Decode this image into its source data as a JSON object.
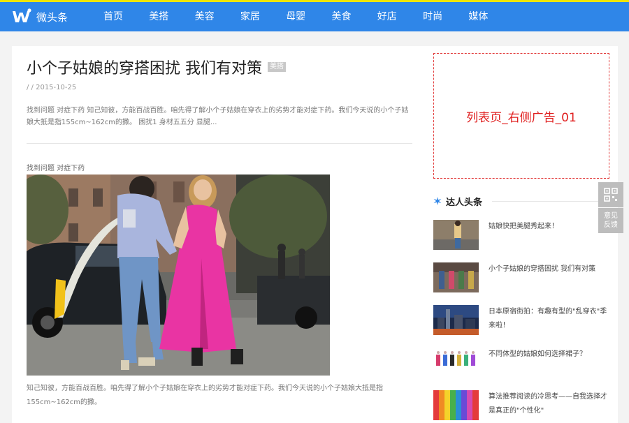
{
  "header": {
    "logo_text": "微头条",
    "nav": [
      "首页",
      "美搭",
      "美容",
      "家居",
      "母婴",
      "美食",
      "好店",
      "时尚",
      "媒体"
    ]
  },
  "article": {
    "title": "小个子姑娘的穿搭困扰 我们有对策",
    "tag": "美搭",
    "meta": "/ / 2015-10-25",
    "summary": "找到问题 对症下药 知己知彼，方能百战百胜。咱先得了解小个子姑娘在穿衣上的劣势才能对症下药。我们今天说的小个子姑娘大抵是指155cm~162cm的撒。 困扰1 身材五五分 显腿...",
    "caption": "找到问题 对症下药",
    "body": "知己知彼，方能百战百胜。咱先得了解小个子姑娘在穿衣上的劣势才能对症下药。我们今天说的小个子姑娘大抵是指155cm~162cm的撒。"
  },
  "ad": {
    "text": "列表页_右侧广告_01"
  },
  "sidebar": {
    "title": "达人头条",
    "items": [
      {
        "text": "姑娘快把美腿秀起来！"
      },
      {
        "text": "小个子姑娘的穿搭困扰 我们有对策"
      },
      {
        "text": "日本原宿街拍：有趣有型的\"乱穿衣\"季来啦！"
      },
      {
        "text": "不同体型的姑娘如何选择裙子？"
      },
      {
        "text": "算法推荐阅读的冷思考——自我选择才是真正的\"个性化\""
      }
    ]
  },
  "float_buttons": {
    "qr_icon": "qr-code-icon",
    "feedback": [
      "意见",
      "反馈"
    ]
  },
  "colors": {
    "nav_bg": "#2f86e8",
    "top_line": "#f0e500",
    "ad_border": "#e23a3a",
    "ad_text": "#e02020",
    "accent_star": "#2f86e8"
  }
}
